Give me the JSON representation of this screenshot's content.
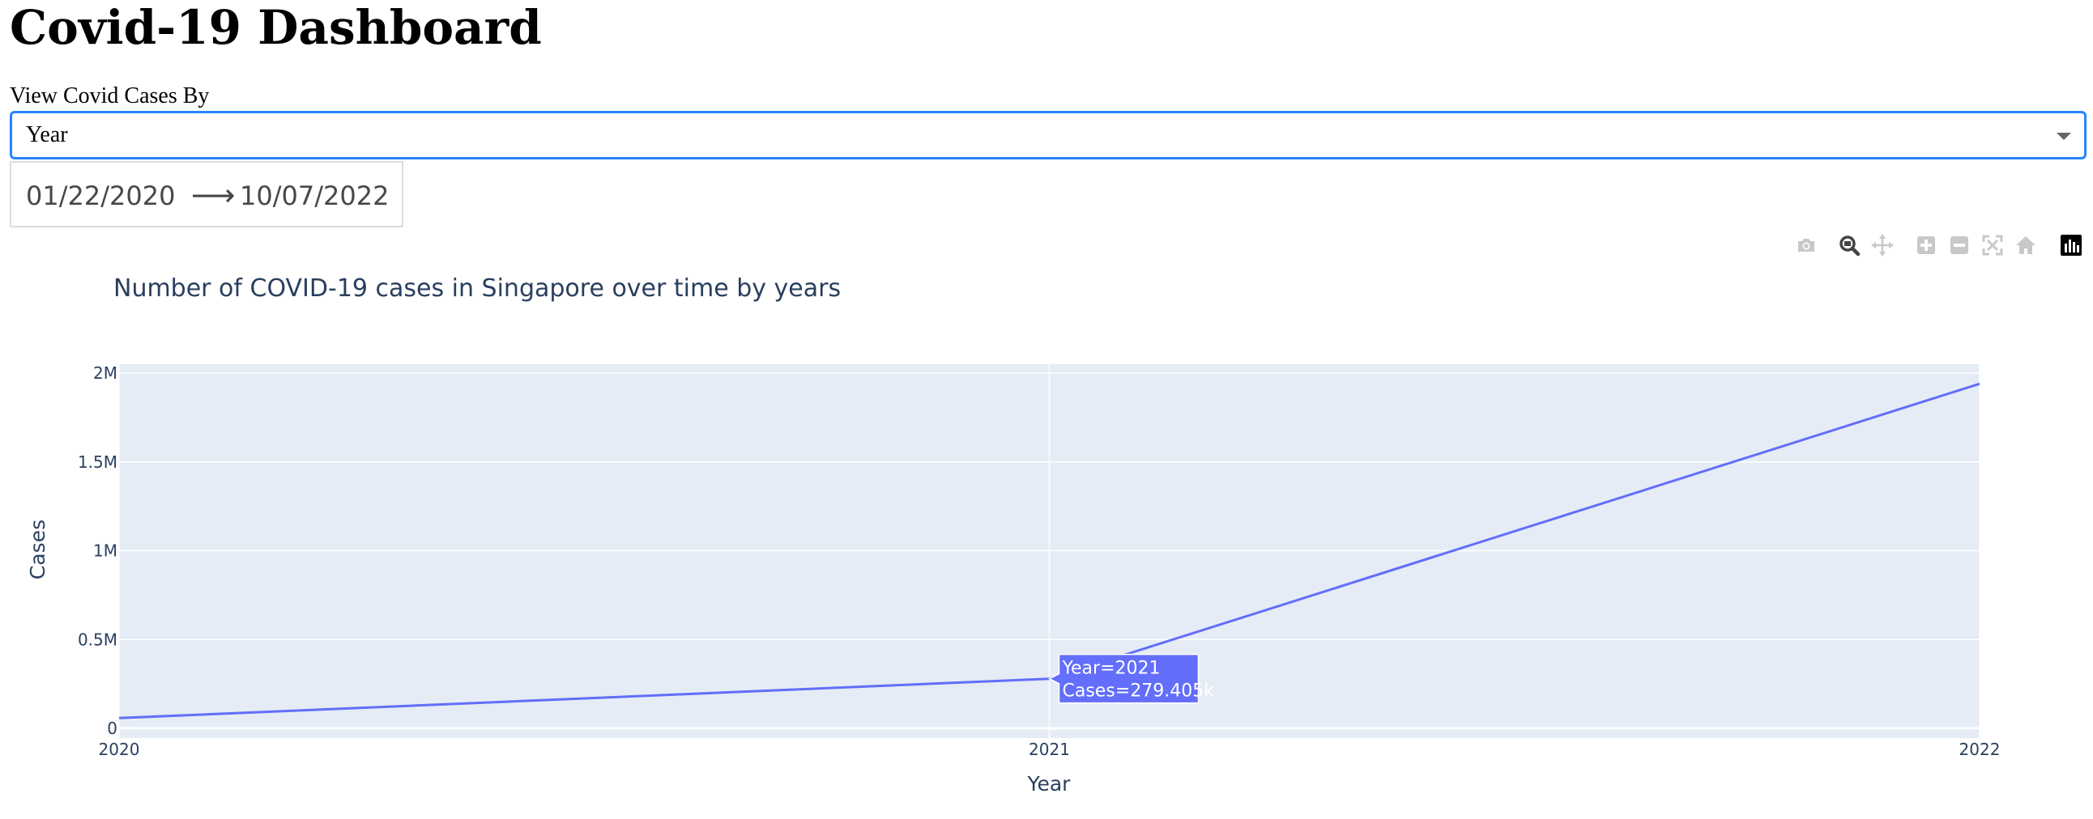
{
  "page": {
    "title": "Covid-19 Dashboard"
  },
  "controls": {
    "view_label": "View Covid Cases By",
    "view_selected": "Year",
    "date_start": "01/22/2020",
    "date_arrow": "⟶",
    "date_end": "10/07/2022"
  },
  "modebar": {
    "icons": [
      "camera-icon",
      "zoom-icon",
      "pan-icon",
      "zoom-in-icon",
      "zoom-out-icon",
      "autoscale-icon",
      "reset-axes-icon",
      "plotly-logo-icon"
    ]
  },
  "colors": {
    "line": "#636efa",
    "plot_bg": "#e5ecf6",
    "text": "#2a3f5f",
    "focus": "#2684ff"
  },
  "chart_data": {
    "type": "line",
    "title": "Number of COVID-19 cases in Singapore over time by years",
    "xlabel": "Year",
    "ylabel": "Cases",
    "x": [
      2020,
      2021,
      2022
    ],
    "series": [
      {
        "values": [
          58000,
          279405,
          1940000
        ]
      }
    ],
    "xlim": [
      2020,
      2022
    ],
    "ylim": [
      0,
      2030000
    ],
    "x_ticks": [
      "2020",
      "2021",
      "2022"
    ],
    "y_ticks": [
      {
        "value": 0,
        "label": "0"
      },
      {
        "value": 500000,
        "label": "0.5M"
      },
      {
        "value": 1000000,
        "label": "1M"
      },
      {
        "value": 1500000,
        "label": "1.5M"
      },
      {
        "value": 2000000,
        "label": "2M"
      }
    ],
    "grid": true,
    "hover": {
      "index": 1,
      "lines": [
        "Year=2021",
        "Cases=279.405k"
      ]
    }
  }
}
